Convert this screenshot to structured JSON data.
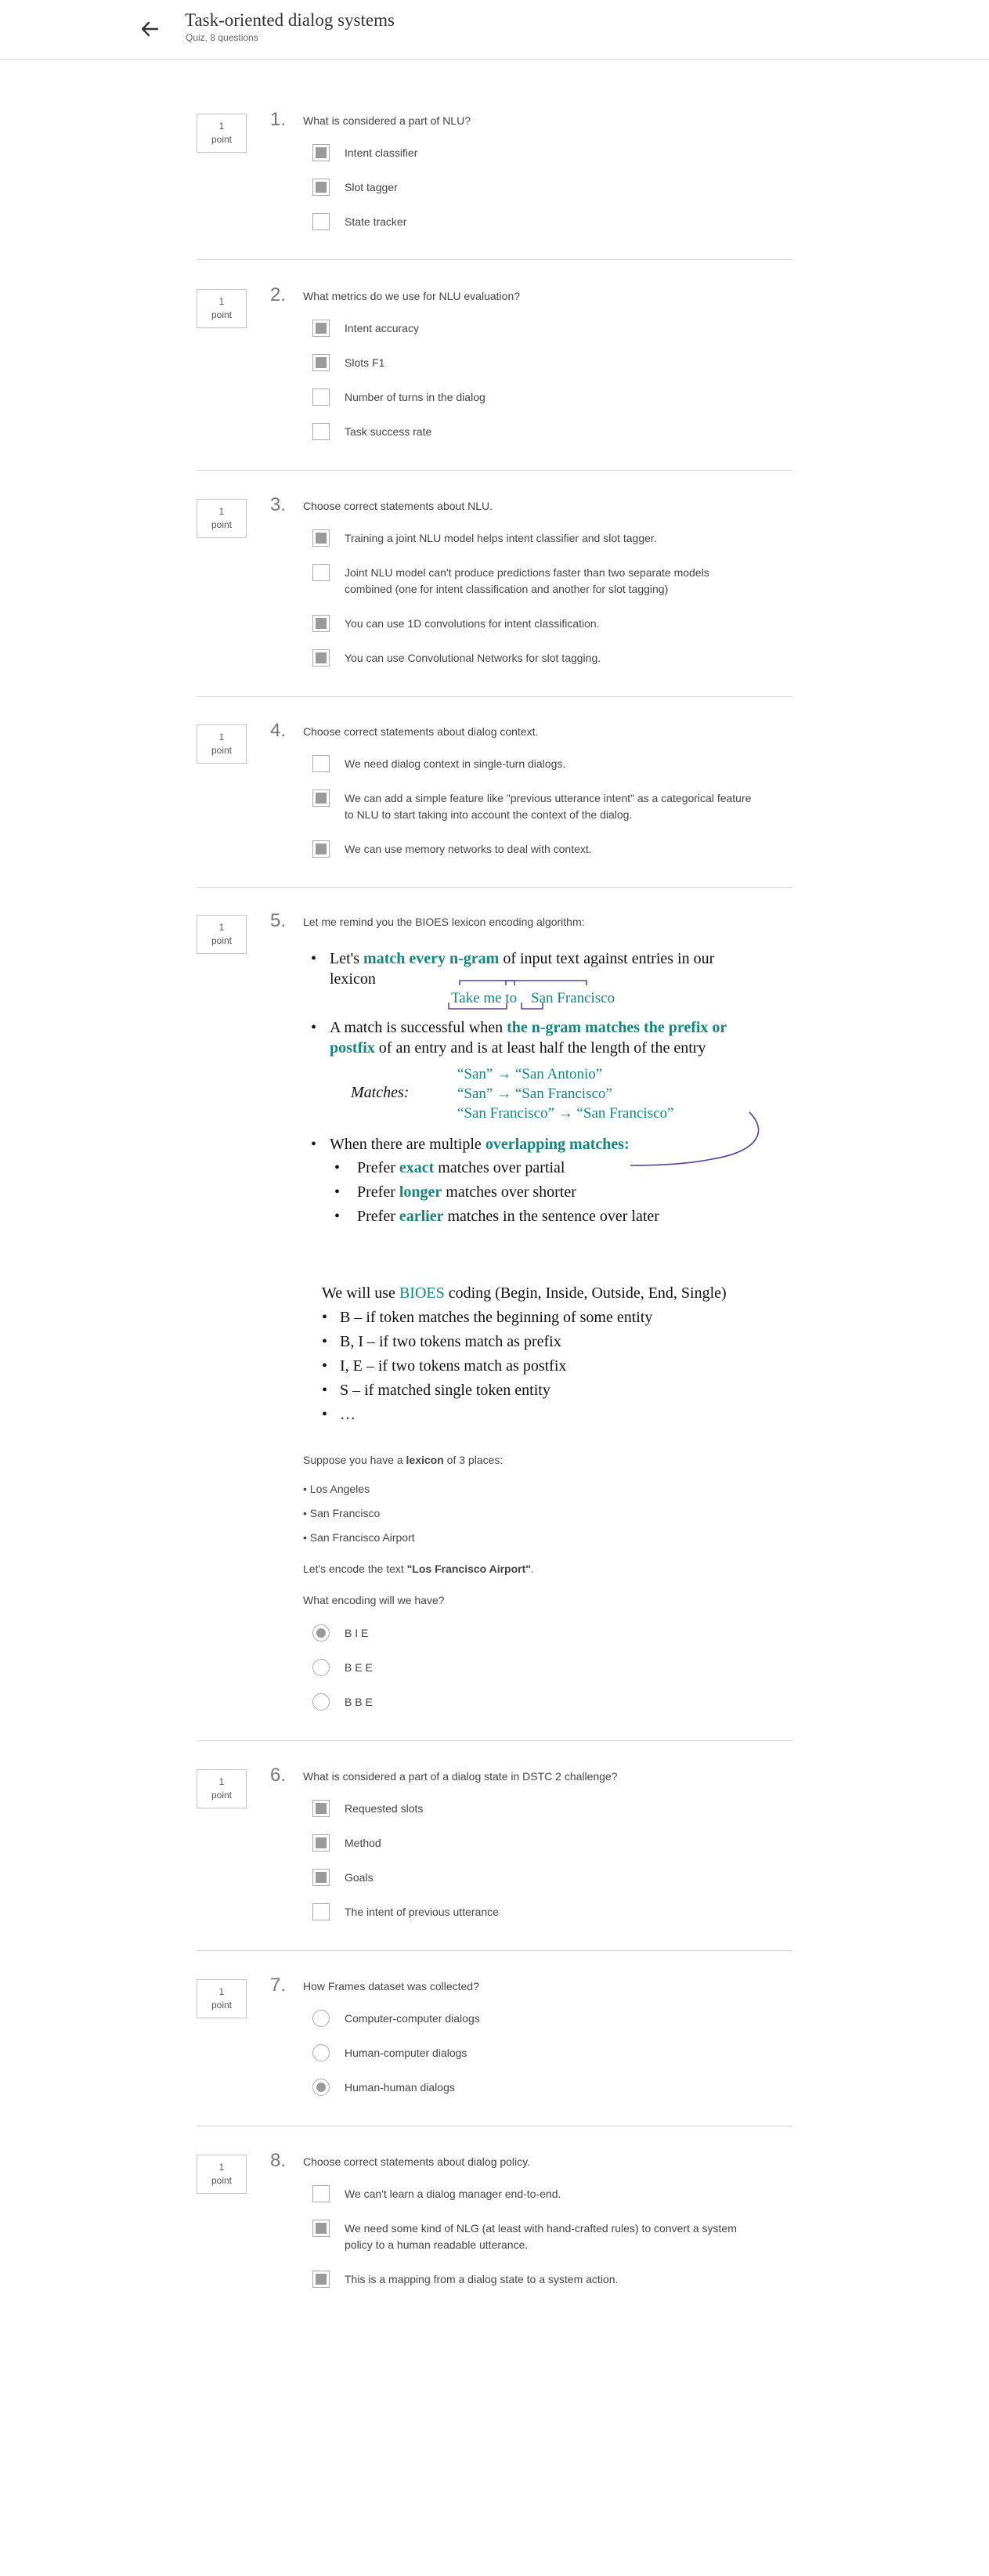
{
  "header": {
    "title": "Task-oriented dialog systems",
    "subtitle": "Quiz, 8 questions"
  },
  "points_value": "1",
  "points_unit": "point",
  "questions": [
    {
      "num": "1.",
      "text": "What is considered a part of NLU?",
      "options": [
        "Intent classifier",
        "Slot tagger",
        "State tracker"
      ],
      "checked": [
        true,
        true,
        false
      ]
    },
    {
      "num": "2.",
      "text": "What metrics do we use for NLU evaluation?",
      "options": [
        "Intent accuracy",
        "Slots F1",
        "Number of turns in the dialog",
        "Task success rate"
      ],
      "checked": [
        true,
        true,
        false,
        false
      ]
    },
    {
      "num": "3.",
      "text": "Choose correct statements about NLU.",
      "options": [
        "Training a joint NLU model helps intent classifier and slot tagger.",
        "Joint NLU model can't produce predictions faster than two separate models combined (one for intent classification and another for slot tagging)",
        "You can use 1D convolutions for intent classification.",
        "You can use Convolutional Networks for slot tagging."
      ],
      "checked": [
        true,
        false,
        true,
        true
      ]
    },
    {
      "num": "4.",
      "text": "Choose correct statements about dialog context.",
      "options": [
        "We need dialog context in single-turn dialogs.",
        "We can add a simple feature like \"previous utterance intent\" as a categorical feature to NLU to start taking into account the context of the dialog.",
        "We can use memory networks to deal with context."
      ],
      "checked": [
        false,
        true,
        true
      ]
    },
    {
      "num": "5.",
      "text": "Let me remind you the BIOES lexicon encoding algorithm:",
      "slide1": {
        "b1_pre": "Let's ",
        "b1_hl": "match every n-gram",
        "b1_post": " of input text against entries in our",
        "b1_line2": "lexicon",
        "ex_left": "Take me to",
        "ex_right": "San Francisco",
        "b2_pre": "A match is successful when ",
        "b2_hl": "the n-gram matches the prefix or",
        "b2_hl2": "postfix",
        "b2_post": " of an entry and is at least half the length of the entry",
        "matches_label": "Matches:",
        "matches": [
          "“San” → “San Antonio”",
          "“San” → “San Francisco”",
          "“San Francisco” → “San Francisco”"
        ],
        "b3_pre": "When there are multiple ",
        "b3_hl": "overlapping matches:",
        "sub": [
          {
            "pre": "Prefer ",
            "hl": "exact",
            "post": " matches over partial"
          },
          {
            "pre": "Prefer ",
            "hl": "longer",
            "post": " matches over shorter"
          },
          {
            "pre": "Prefer ",
            "hl": "earlier",
            "post": " matches in the sentence over later"
          }
        ]
      },
      "slide2": {
        "intro_pre": "We will use ",
        "intro_hl": "BIOES",
        "intro_post": " coding (Begin, Inside, Outside, End, Single)",
        "items": [
          "B – if token matches the beginning of some entity",
          "B, I – if two tokens match as prefix",
          "I, E – if two tokens match as postfix",
          "S – if matched single token entity",
          "…"
        ]
      },
      "lexicon_pre": "Suppose you have a ",
      "lexicon_bold": "lexicon",
      "lexicon_post": " of 3 places:",
      "places": [
        "Los Angeles",
        "San Francisco",
        "San Francisco Airport"
      ],
      "encode_pre": "Let's encode the text ",
      "encode_bold": "\"Los Francisco Airport\"",
      "encode_post": ".",
      "ask": "What encoding will we have?",
      "options": [
        "B I E",
        "B E E",
        "B B E"
      ],
      "checked": [
        true,
        false,
        false
      ]
    },
    {
      "num": "6.",
      "text": "What is considered a part of a dialog state in DSTC 2 challenge?",
      "options": [
        "Requested slots",
        "Method",
        "Goals",
        "The intent of previous utterance"
      ],
      "checked": [
        true,
        true,
        true,
        false
      ]
    },
    {
      "num": "7.",
      "text": "How Frames dataset was collected?",
      "options": [
        "Computer-computer dialogs",
        "Human-computer dialogs",
        "Human-human dialogs"
      ],
      "checked": [
        false,
        false,
        true
      ]
    },
    {
      "num": "8.",
      "text": "Choose correct statements about dialog policy.",
      "options": [
        "We can't learn a dialog manager end-to-end.",
        "We need some kind of NLG (at least with hand-crafted rules) to convert a system policy to a human readable utterance.",
        "This is a mapping from a dialog state to a system action."
      ],
      "checked": [
        false,
        true,
        true
      ]
    }
  ]
}
